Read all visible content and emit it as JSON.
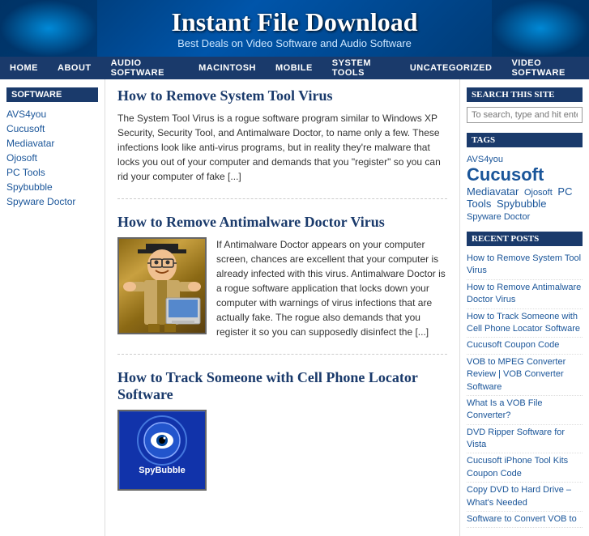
{
  "header": {
    "title": "Instant File Download",
    "subtitle": "Best Deals on Video Software and Audio Software"
  },
  "nav": {
    "items": [
      {
        "label": "HOME",
        "active": false
      },
      {
        "label": "ABOUT",
        "active": false
      },
      {
        "label": "AUDIO SOFTWARE",
        "active": false
      },
      {
        "label": "MACINTOSH",
        "active": false
      },
      {
        "label": "MOBILE",
        "active": false
      },
      {
        "label": "SYSTEM TOOLS",
        "active": false
      },
      {
        "label": "UNCATEGORIZED",
        "active": false
      },
      {
        "label": "VIDEO SOFTWARE",
        "active": false
      }
    ]
  },
  "sidebar": {
    "title": "SOFTWARE",
    "links": [
      "AVS4you",
      "Cucusoft",
      "Mediavatar",
      "Ojosoft",
      "PC Tools",
      "Spybubble",
      "Spyware Doctor"
    ]
  },
  "posts": [
    {
      "id": "post1",
      "title": "How to Remove System Tool Virus",
      "excerpt": "The System Tool Virus is a rogue software program similar to Windows XP Security, Security Tool, and Antimalware Doctor, to name only a few. These infections look like anti-virus programs, but in reality they're malware that locks you out of your computer and demands that you \"register\" so you can rid your computer of fake [...]",
      "has_image": false
    },
    {
      "id": "post2",
      "title": "How to Remove Antimalware Doctor Virus",
      "excerpt": "If Antimalware Doctor appears on your computer screen, chances are excellent that your computer is already infected with this virus. Antimalware Doctor is a rogue software application that locks down your computer with warnings of virus infections that are actually fake. The rogue also demands that you register it so you can supposedly disinfect the [...]",
      "has_image": true,
      "image_type": "doctor"
    },
    {
      "id": "post3",
      "title": "How to Track Someone with Cell Phone Locator Software",
      "has_image": true,
      "image_type": "spybubble"
    }
  ],
  "right_sidebar": {
    "search": {
      "title": "SEARCH THIS SITE",
      "placeholder": "To search, type and hit enter"
    },
    "tags": {
      "title": "Tags",
      "items": [
        {
          "label": "AVS4you",
          "size": "small"
        },
        {
          "label": "Cucusoft",
          "size": "large"
        },
        {
          "label": "Mediavatar",
          "size": "medium"
        },
        {
          "label": "Ojosoft",
          "size": "small"
        },
        {
          "label": "PC Tools",
          "size": "medium"
        },
        {
          "label": "Spybubble",
          "size": "medium"
        },
        {
          "label": "Spyware Doctor",
          "size": "small"
        }
      ]
    },
    "recent_posts": {
      "title": "Recent Posts",
      "items": [
        "How to Remove System Tool Virus",
        "How to Remove Antimalware Doctor Virus",
        "How to Track Someone with Cell Phone Locator Software",
        "Cucusoft Coupon Code",
        "VOB to MPEG Converter Review | VOB Converter Software",
        "What Is a VOB File Converter?",
        "DVD Ripper Software for Vista",
        "Cucusoft iPhone Tool Kits Coupon Code",
        "Copy DVD to Hard Drive – What's Needed",
        "Software to Convert VOB to"
      ]
    }
  }
}
